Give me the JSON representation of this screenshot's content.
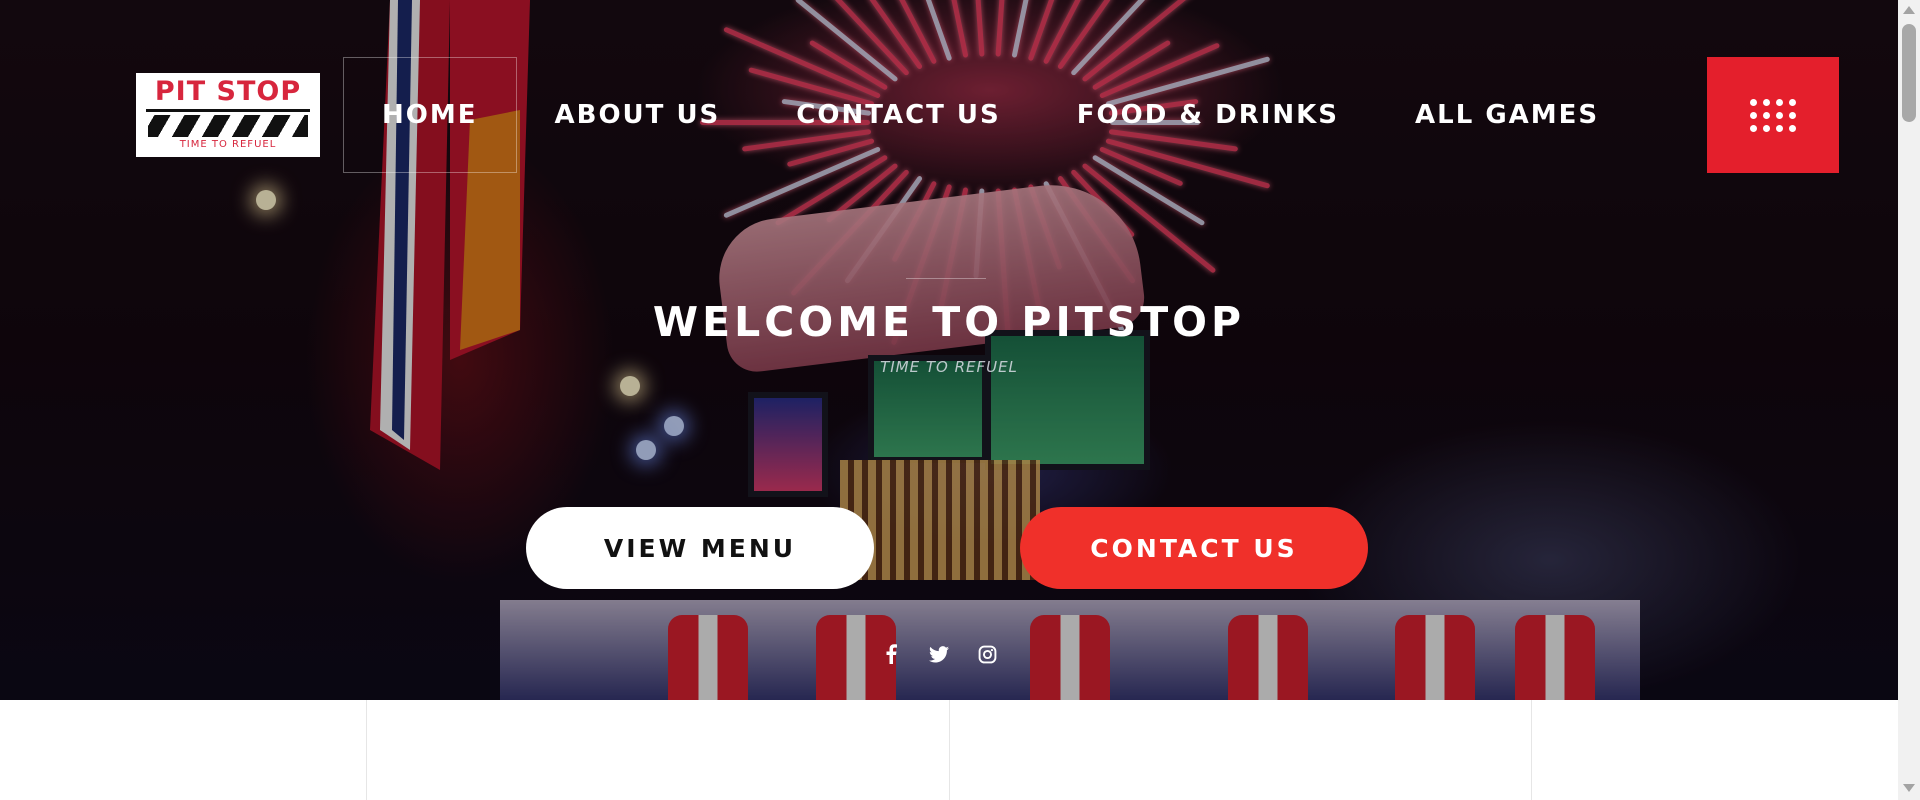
{
  "brand": {
    "logo_title": "PIT STOP",
    "logo_tagline": "TIME TO REFUEL"
  },
  "nav": {
    "items": [
      {
        "label": "HOME",
        "active": true
      },
      {
        "label": "ABOUT US",
        "active": false
      },
      {
        "label": "CONTACT US",
        "active": false
      },
      {
        "label": "FOOD & DRINKS",
        "active": false
      },
      {
        "label": "ALL GAMES",
        "active": false
      }
    ],
    "menu_icon": "grid-dots-icon"
  },
  "hero": {
    "title": "WELCOME TO PITSTOP",
    "subtitle": "TIME TO REFUEL",
    "primary_button": "VIEW MENU",
    "secondary_button": "CONTACT US",
    "social_icons": [
      "facebook-icon",
      "twitter-icon",
      "instagram-icon"
    ]
  },
  "colors": {
    "accent_red": "#e41f2c",
    "button_red": "#f0302a",
    "text_white": "#ffffff"
  }
}
